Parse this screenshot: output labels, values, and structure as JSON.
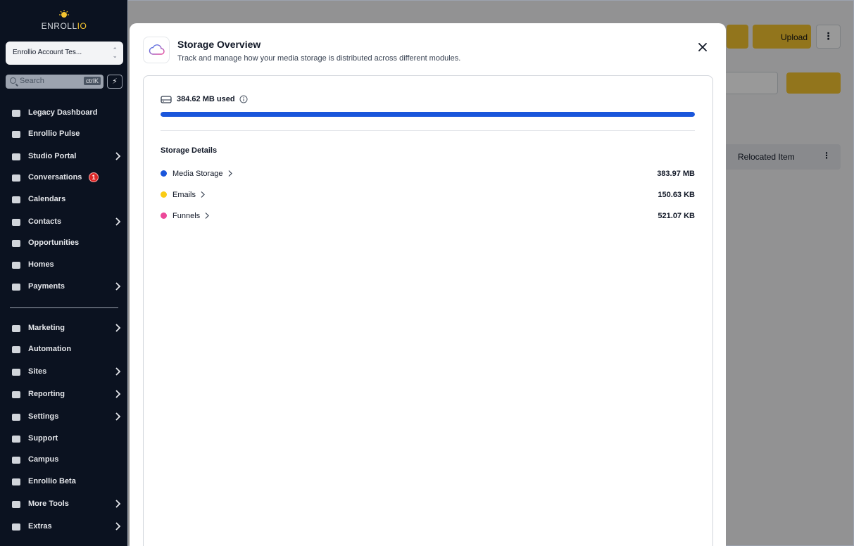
{
  "sidebar": {
    "logo": {
      "brand_main": "ENROLL",
      "brand_accent": "IO"
    },
    "account_name": "Enrollio Account Tes...",
    "search": {
      "placeholder": "Search",
      "shortcut": "ctrlK"
    },
    "nav_items": [
      {
        "label": "Legacy Dashboard",
        "icon": "chart-bars-icon"
      },
      {
        "label": "Enrollio Pulse",
        "icon": "pie-chart-icon"
      },
      {
        "label": "Studio Portal",
        "icon": "users-icon"
      },
      {
        "label": "Conversations",
        "icon": "chat-icon",
        "badge": "1"
      },
      {
        "label": "Calendars",
        "icon": "calendar-icon"
      },
      {
        "label": "Contacts",
        "icon": "contacts-icon"
      },
      {
        "label": "Opportunities",
        "icon": "lightbulb-icon"
      },
      {
        "label": "Homes",
        "icon": "box-icon"
      },
      {
        "label": "Payments",
        "icon": "coin-icon"
      },
      {
        "label": "Marketing",
        "icon": "megaphone-icon"
      },
      {
        "label": "Automation",
        "icon": "workflow-icon"
      },
      {
        "label": "Sites",
        "icon": "globe-icon"
      },
      {
        "label": "Reporting",
        "icon": "report-pie-icon"
      },
      {
        "label": "Settings",
        "icon": "gear-icon"
      },
      {
        "label": "Support",
        "icon": "headset-icon"
      },
      {
        "label": "Campus",
        "icon": "bulb-icon"
      },
      {
        "label": "Enrollio Beta",
        "icon": "wordpress-icon"
      },
      {
        "label": "More Tools",
        "icon": "robot-icon"
      },
      {
        "label": "Extras",
        "icon": "bell-icon"
      }
    ]
  },
  "background": {
    "upload_label": "Upload",
    "folder_item": "Relocated Item",
    "more_label": "⋮"
  },
  "modal": {
    "title": "Storage Overview",
    "subtitle": "Track and manage how your media storage is distributed across different modules.",
    "used_label": "384.62 MB used",
    "used_fraction": 1.0,
    "details_title": "Storage Details",
    "items": [
      {
        "name": "Media Storage",
        "size": "383.97 MB",
        "color": "#1a56db"
      },
      {
        "name": "Emails",
        "size": "150.63 KB",
        "color": "#facc15"
      },
      {
        "name": "Funnels",
        "size": "521.07 KB",
        "color": "#ec4899"
      }
    ]
  }
}
